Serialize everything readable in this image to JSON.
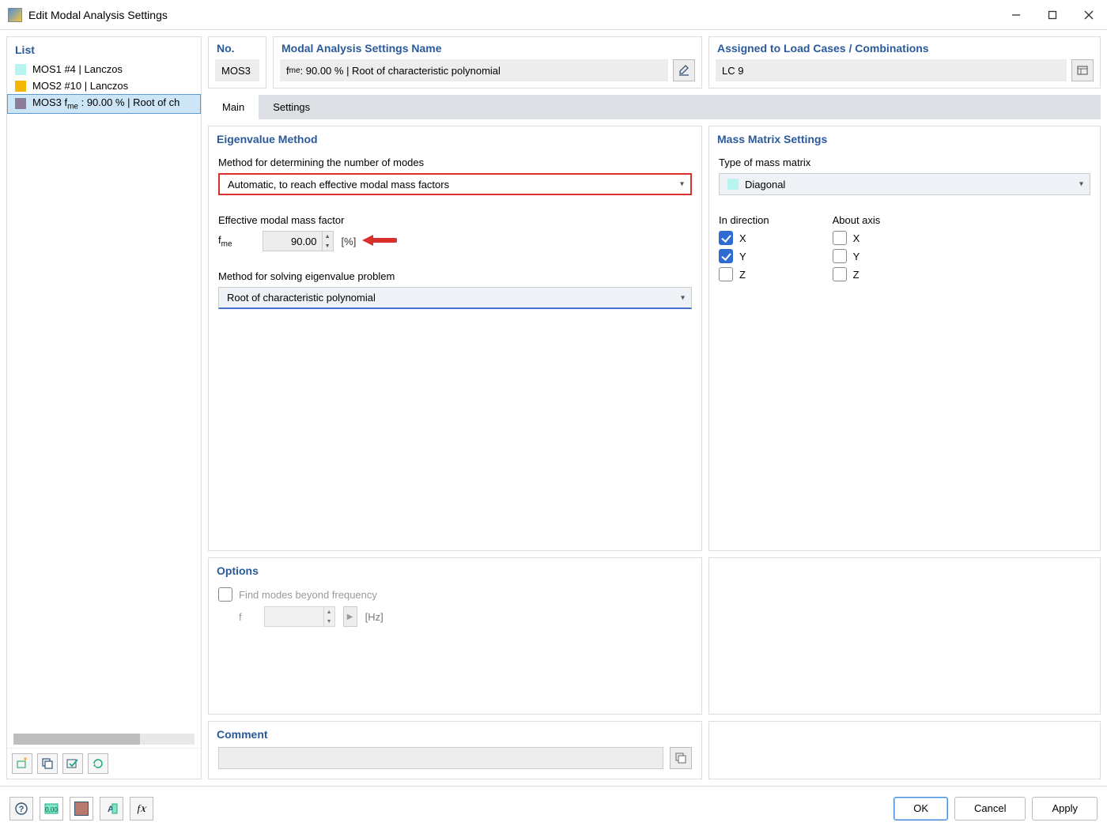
{
  "window": {
    "title": "Edit Modal Analysis Settings"
  },
  "list": {
    "header": "List",
    "items": [
      {
        "color": "#b8f5f0",
        "label": "MOS1 #4 | Lanczos"
      },
      {
        "color": "#f2b705",
        "label": "MOS2 #10 | Lanczos"
      },
      {
        "color": "#8a7d9a",
        "label": "MOS3 fme : 90.00 % | Root of ch"
      }
    ],
    "selected_index": 2
  },
  "header": {
    "no_label": "No.",
    "no_value": "MOS3",
    "name_label": "Modal Analysis Settings Name",
    "name_value": "fme : 90.00 % | Root of characteristic polynomial",
    "assigned_label": "Assigned to Load Cases / Combinations",
    "assigned_value": "LC 9"
  },
  "tabs": {
    "items": [
      "Main",
      "Settings"
    ],
    "active": 0
  },
  "eigen": {
    "header": "Eigenvalue Method",
    "method_modes_label": "Method for determining the number of modes",
    "method_modes_value": "Automatic, to reach effective modal mass factors",
    "fme_label": "Effective modal mass factor",
    "fme_sym_prefix": "f",
    "fme_sym_sub": "me",
    "fme_value": "90.00",
    "fme_unit": "[%]",
    "solver_label": "Method for solving eigenvalue problem",
    "solver_value": "Root of characteristic polynomial"
  },
  "mass": {
    "header": "Mass Matrix Settings",
    "type_label": "Type of mass matrix",
    "type_value": "Diagonal",
    "dir_label": "In direction",
    "axis_label": "About axis",
    "dir": {
      "x": {
        "label": "X",
        "checked": true
      },
      "y": {
        "label": "Y",
        "checked": true
      },
      "z": {
        "label": "Z",
        "checked": false
      }
    },
    "axis": {
      "x": {
        "label": "X",
        "checked": false
      },
      "y": {
        "label": "Y",
        "checked": false
      },
      "z": {
        "label": "Z",
        "checked": false
      }
    }
  },
  "options": {
    "header": "Options",
    "find_label": "Find modes beyond frequency",
    "find_checked": false,
    "f_sym": "f",
    "f_unit": "[Hz]"
  },
  "comment": {
    "header": "Comment",
    "value": ""
  },
  "buttons": {
    "ok": "OK",
    "cancel": "Cancel",
    "apply": "Apply"
  }
}
